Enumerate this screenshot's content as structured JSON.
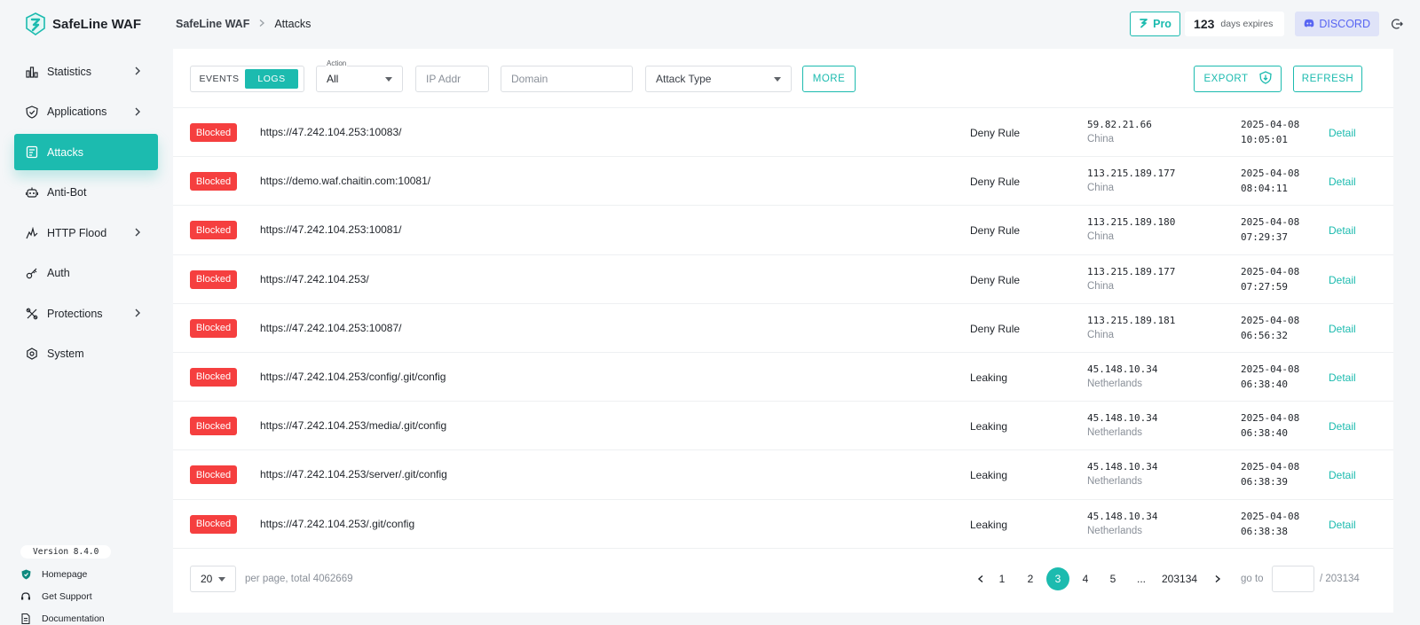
{
  "app": {
    "name": "SafeLine WAF"
  },
  "sidebar": {
    "items": [
      {
        "label": "Statistics",
        "icon": "bar-chart-icon",
        "has_submenu": true
      },
      {
        "label": "Applications",
        "icon": "shield-icon",
        "has_submenu": true
      },
      {
        "label": "Attacks",
        "icon": "clipboard-icon",
        "has_submenu": false,
        "active": true
      },
      {
        "label": "Anti-Bot",
        "icon": "robot-icon",
        "has_submenu": false
      },
      {
        "label": "HTTP Flood",
        "icon": "flood-icon",
        "has_submenu": true
      },
      {
        "label": "Auth",
        "icon": "key-icon",
        "has_submenu": false
      },
      {
        "label": "Protections",
        "icon": "tools-icon",
        "has_submenu": true
      },
      {
        "label": "System",
        "icon": "gear-icon",
        "has_submenu": false
      }
    ],
    "footer": {
      "version": "Version 8.4.0",
      "links": [
        {
          "label": "Homepage",
          "icon": "shield-small-icon"
        },
        {
          "label": "Get Support",
          "icon": "headset-icon"
        },
        {
          "label": "Documentation",
          "icon": "document-icon"
        }
      ]
    }
  },
  "header": {
    "breadcrumb": {
      "root": "SafeLine WAF",
      "current": "Attacks"
    },
    "pro_label": "Pro",
    "days_count": "123",
    "days_label": "days expires",
    "discord_label": "DISCORD"
  },
  "toolbar": {
    "events_label": "EVENTS",
    "logs_label": "LOGS",
    "action_label": "Action",
    "action_value": "All",
    "ip_placeholder": "IP Addr",
    "domain_placeholder": "Domain",
    "attack_type_placeholder": "Attack Type",
    "more_label": "MORE",
    "export_label": "EXPORT",
    "refresh_label": "REFRESH"
  },
  "rows": [
    {
      "status": "Blocked",
      "url": "https://47.242.104.253:10083/",
      "rule": "Deny Rule",
      "ip": "59.82.21.66",
      "country": "China",
      "date": "2025-04-08",
      "time": "10:05:01",
      "action": "Detail"
    },
    {
      "status": "Blocked",
      "url": "https://demo.waf.chaitin.com:10081/",
      "rule": "Deny Rule",
      "ip": "113.215.189.177",
      "country": "China",
      "date": "2025-04-08",
      "time": "08:04:11",
      "action": "Detail"
    },
    {
      "status": "Blocked",
      "url": "https://47.242.104.253:10081/",
      "rule": "Deny Rule",
      "ip": "113.215.189.180",
      "country": "China",
      "date": "2025-04-08",
      "time": "07:29:37",
      "action": "Detail"
    },
    {
      "status": "Blocked",
      "url": "https://47.242.104.253/",
      "rule": "Deny Rule",
      "ip": "113.215.189.177",
      "country": "China",
      "date": "2025-04-08",
      "time": "07:27:59",
      "action": "Detail"
    },
    {
      "status": "Blocked",
      "url": "https://47.242.104.253:10087/",
      "rule": "Deny Rule",
      "ip": "113.215.189.181",
      "country": "China",
      "date": "2025-04-08",
      "time": "06:56:32",
      "action": "Detail"
    },
    {
      "status": "Blocked",
      "url": "https://47.242.104.253/config/.git/config",
      "rule": "Leaking",
      "ip": "45.148.10.34",
      "country": "Netherlands",
      "date": "2025-04-08",
      "time": "06:38:40",
      "action": "Detail"
    },
    {
      "status": "Blocked",
      "url": "https://47.242.104.253/media/.git/config",
      "rule": "Leaking",
      "ip": "45.148.10.34",
      "country": "Netherlands",
      "date": "2025-04-08",
      "time": "06:38:40",
      "action": "Detail"
    },
    {
      "status": "Blocked",
      "url": "https://47.242.104.253/server/.git/config",
      "rule": "Leaking",
      "ip": "45.148.10.34",
      "country": "Netherlands",
      "date": "2025-04-08",
      "time": "06:38:39",
      "action": "Detail"
    },
    {
      "status": "Blocked",
      "url": "https://47.242.104.253/.git/config",
      "rule": "Leaking",
      "ip": "45.148.10.34",
      "country": "Netherlands",
      "date": "2025-04-08",
      "time": "06:38:38",
      "action": "Detail"
    }
  ],
  "pagination": {
    "page_size": "20",
    "total_text": "per page, total 4062669",
    "pages": [
      "1",
      "2",
      "3",
      "4",
      "5",
      "...",
      "203134"
    ],
    "current_page": "3",
    "goto_label": "go to",
    "goto_total": "/ 203134"
  },
  "colors": {
    "accent": "#1cbbaf",
    "danger": "#f53f3f",
    "discord": "#5865f2"
  }
}
